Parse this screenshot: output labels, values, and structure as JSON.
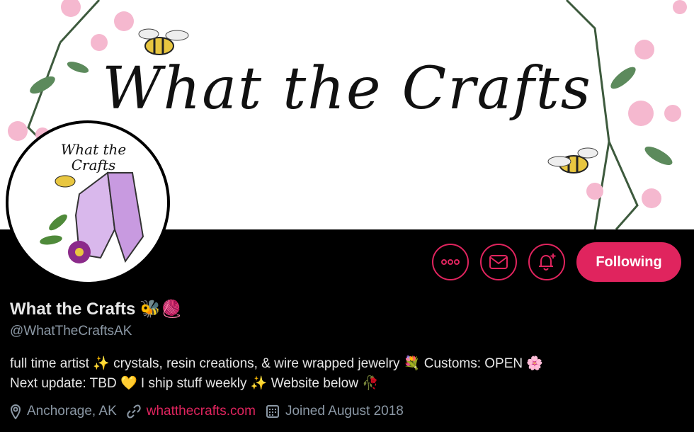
{
  "banner": {
    "title": "What the Crafts"
  },
  "avatar": {
    "text": "What the Crafts"
  },
  "actions": {
    "more_icon": "ellipsis-icon",
    "message_icon": "mail-icon",
    "notify_icon": "bell-plus-icon",
    "follow_label": "Following"
  },
  "profile": {
    "name": "What the Crafts",
    "name_emojis": "🐝🧶",
    "handle": "@WhatTheCraftsAK",
    "bio_line1": "full time artist ✨ crystals, resin creations, & wire wrapped jewelry 💐 Customs: OPEN 🌸",
    "bio_line2": "Next update: TBD 💛 I ship stuff weekly ✨ Website below 🥀",
    "location": "Anchorage, AK",
    "website": "whatthecrafts.com",
    "joined": "Joined August 2018"
  },
  "colors": {
    "accent": "#e0245e",
    "muted": "#8b98a5",
    "text": "#e6e6e6",
    "background": "#000000"
  }
}
